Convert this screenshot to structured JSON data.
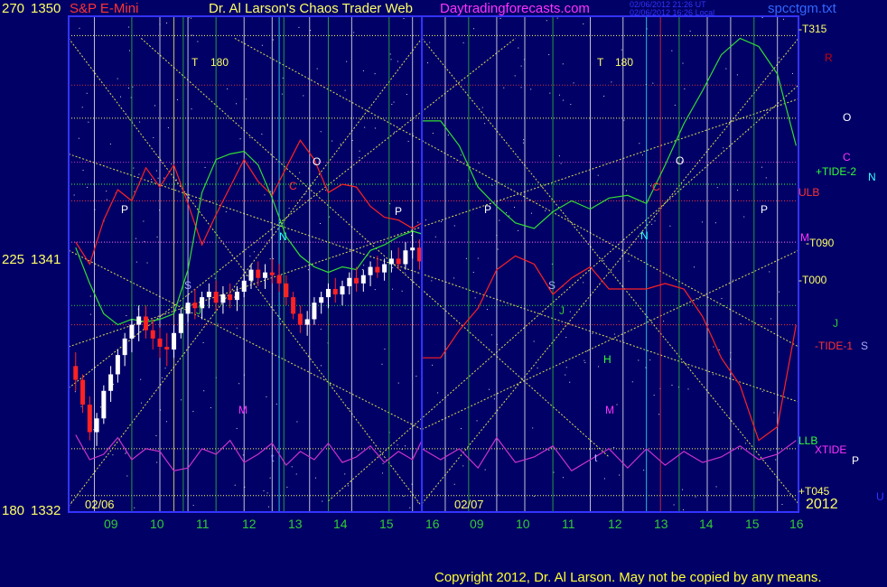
{
  "header": {
    "left_axis_label": "270",
    "top_price": "1350",
    "symbol": "S&P E-Mini",
    "title": "Dr. Al Larson's Chaos Trader Web",
    "site": "Daytradingforecasts.com",
    "stamp_line1": "02/06/2012 21:26 UT",
    "stamp_line2": "02/06/2012 16:26 Local",
    "filename": "spcctgm.txt"
  },
  "y_axis": {
    "mid_left": "225",
    "mid_price": "1341",
    "bottom_left": "180",
    "bottom_price": "1332"
  },
  "x_axis": {
    "day1_ticks": [
      "09",
      "10",
      "11",
      "12",
      "13",
      "14",
      "15",
      "16"
    ],
    "day2_ticks": [
      "09",
      "10",
      "11",
      "12",
      "13",
      "14",
      "15",
      "16"
    ],
    "date1": "02/06",
    "date2": "02/07",
    "year": "2012"
  },
  "right_labels": {
    "t315": "-T315",
    "r": "R",
    "o": "O",
    "c": "C",
    "tide2": "+TIDE-2",
    "n": "N",
    "ulb": "ULB",
    "m": "M",
    "t090": "-T090",
    "t000": "-T000",
    "j": "J",
    "tide1": "-TIDE-1",
    "s": "S",
    "llb": "LLB",
    "xtide": "XTIDE",
    "p": "P",
    "t045": "+T045",
    "u": "U"
  },
  "plot_letters": {
    "t1": "T",
    "t1_deg": "180",
    "t2": "T",
    "t2_deg": "180",
    "letters": [
      "P",
      "O",
      "C",
      "N",
      "P",
      "S",
      "J",
      "M",
      "t",
      "P",
      "S",
      "J",
      "H",
      "M",
      "N",
      "O",
      "C",
      "P",
      "t"
    ]
  },
  "copyright": "Copyright 2012, Dr. Al Larson. May not be copied by any means.",
  "chart_data": {
    "type": "line",
    "title": "S&P E-Mini",
    "ylim": [
      1332,
      1350
    ],
    "y_ticks": [
      1332,
      1341,
      1350
    ],
    "x_ticks_day1": [
      "09",
      "10",
      "11",
      "12",
      "13",
      "14",
      "15",
      "16"
    ],
    "x_ticks_day2": [
      "09",
      "10",
      "11",
      "12",
      "13",
      "14",
      "15",
      "16"
    ],
    "price_bars_day1": [
      {
        "x": 8.6,
        "o": 1337.3,
        "h": 1337.8,
        "l": 1336.4,
        "c": 1336.8
      },
      {
        "x": 8.75,
        "o": 1336.8,
        "h": 1337.0,
        "l": 1335.6,
        "c": 1335.9
      },
      {
        "x": 8.9,
        "o": 1335.9,
        "h": 1336.2,
        "l": 1334.6,
        "c": 1334.9
      },
      {
        "x": 9.05,
        "o": 1334.9,
        "h": 1335.6,
        "l": 1334.4,
        "c": 1335.4
      },
      {
        "x": 9.2,
        "o": 1335.4,
        "h": 1336.6,
        "l": 1335.2,
        "c": 1336.4
      },
      {
        "x": 9.35,
        "o": 1336.4,
        "h": 1337.3,
        "l": 1336.0,
        "c": 1337.0
      },
      {
        "x": 9.5,
        "o": 1337.0,
        "h": 1337.9,
        "l": 1336.7,
        "c": 1337.7
      },
      {
        "x": 9.65,
        "o": 1337.7,
        "h": 1338.5,
        "l": 1337.3,
        "c": 1338.3
      },
      {
        "x": 9.8,
        "o": 1338.3,
        "h": 1339.0,
        "l": 1337.8,
        "c": 1338.8
      },
      {
        "x": 9.95,
        "o": 1338.8,
        "h": 1339.5,
        "l": 1338.2,
        "c": 1339.1
      },
      {
        "x": 10.1,
        "o": 1339.1,
        "h": 1339.5,
        "l": 1338.3,
        "c": 1338.6
      },
      {
        "x": 10.25,
        "o": 1338.6,
        "h": 1339.0,
        "l": 1337.9,
        "c": 1338.3
      },
      {
        "x": 10.4,
        "o": 1338.3,
        "h": 1338.7,
        "l": 1337.6,
        "c": 1338.0
      },
      {
        "x": 10.55,
        "o": 1338.0,
        "h": 1338.5,
        "l": 1337.3,
        "c": 1337.9
      },
      {
        "x": 10.7,
        "o": 1337.9,
        "h": 1338.8,
        "l": 1337.6,
        "c": 1338.5
      },
      {
        "x": 10.85,
        "o": 1338.5,
        "h": 1339.4,
        "l": 1338.3,
        "c": 1339.2
      },
      {
        "x": 11.0,
        "o": 1339.2,
        "h": 1339.9,
        "l": 1338.9,
        "c": 1339.6
      },
      {
        "x": 11.15,
        "o": 1339.6,
        "h": 1340.1,
        "l": 1339.0,
        "c": 1339.4
      },
      {
        "x": 11.3,
        "o": 1339.4,
        "h": 1340.0,
        "l": 1339.0,
        "c": 1339.8
      },
      {
        "x": 11.45,
        "o": 1339.8,
        "h": 1340.3,
        "l": 1339.4,
        "c": 1340.0
      },
      {
        "x": 11.6,
        "o": 1340.0,
        "h": 1340.4,
        "l": 1339.3,
        "c": 1339.6
      },
      {
        "x": 11.75,
        "o": 1339.6,
        "h": 1340.2,
        "l": 1339.2,
        "c": 1339.9
      },
      {
        "x": 11.9,
        "o": 1339.9,
        "h": 1340.3,
        "l": 1339.4,
        "c": 1339.7
      },
      {
        "x": 12.05,
        "o": 1339.7,
        "h": 1340.2,
        "l": 1339.3,
        "c": 1340.0
      },
      {
        "x": 12.2,
        "o": 1340.0,
        "h": 1340.6,
        "l": 1339.8,
        "c": 1340.4
      },
      {
        "x": 12.35,
        "o": 1340.4,
        "h": 1341.0,
        "l": 1340.1,
        "c": 1340.8
      },
      {
        "x": 12.5,
        "o": 1340.8,
        "h": 1341.1,
        "l": 1340.2,
        "c": 1340.5
      },
      {
        "x": 12.65,
        "o": 1340.5,
        "h": 1341.0,
        "l": 1340.1,
        "c": 1340.7
      },
      {
        "x": 12.8,
        "o": 1340.7,
        "h": 1341.2,
        "l": 1340.3,
        "c": 1340.6
      },
      {
        "x": 12.95,
        "o": 1340.6,
        "h": 1341.0,
        "l": 1340.0,
        "c": 1340.3
      },
      {
        "x": 13.1,
        "o": 1340.3,
        "h": 1340.6,
        "l": 1339.5,
        "c": 1339.8
      },
      {
        "x": 13.25,
        "o": 1339.8,
        "h": 1340.0,
        "l": 1339.0,
        "c": 1339.2
      },
      {
        "x": 13.4,
        "o": 1339.2,
        "h": 1339.5,
        "l": 1338.5,
        "c": 1338.8
      },
      {
        "x": 13.55,
        "o": 1338.8,
        "h": 1339.3,
        "l": 1338.4,
        "c": 1339.0
      },
      {
        "x": 13.7,
        "o": 1339.0,
        "h": 1339.8,
        "l": 1338.8,
        "c": 1339.6
      },
      {
        "x": 13.85,
        "o": 1339.6,
        "h": 1340.0,
        "l": 1339.2,
        "c": 1339.8
      },
      {
        "x": 14.0,
        "o": 1339.8,
        "h": 1340.3,
        "l": 1339.4,
        "c": 1340.1
      },
      {
        "x": 14.15,
        "o": 1340.1,
        "h": 1340.5,
        "l": 1339.6,
        "c": 1339.9
      },
      {
        "x": 14.3,
        "o": 1339.9,
        "h": 1340.4,
        "l": 1339.5,
        "c": 1340.2
      },
      {
        "x": 14.45,
        "o": 1340.2,
        "h": 1340.7,
        "l": 1339.9,
        "c": 1340.5
      },
      {
        "x": 14.6,
        "o": 1340.5,
        "h": 1340.9,
        "l": 1340.0,
        "c": 1340.3
      },
      {
        "x": 14.75,
        "o": 1340.3,
        "h": 1340.8,
        "l": 1340.0,
        "c": 1340.6
      },
      {
        "x": 14.9,
        "o": 1340.6,
        "h": 1341.1,
        "l": 1340.2,
        "c": 1340.9
      },
      {
        "x": 15.05,
        "o": 1340.9,
        "h": 1341.3,
        "l": 1340.5,
        "c": 1340.7
      },
      {
        "x": 15.2,
        "o": 1340.7,
        "h": 1341.2,
        "l": 1340.4,
        "c": 1341.0
      },
      {
        "x": 15.35,
        "o": 1341.0,
        "h": 1341.5,
        "l": 1340.7,
        "c": 1341.2
      },
      {
        "x": 15.5,
        "o": 1341.2,
        "h": 1341.6,
        "l": 1340.8,
        "c": 1341.0
      },
      {
        "x": 15.65,
        "o": 1341.0,
        "h": 1341.8,
        "l": 1340.8,
        "c": 1341.5
      },
      {
        "x": 15.8,
        "o": 1341.5,
        "h": 1342.2,
        "l": 1341.2,
        "c": 1341.6
      },
      {
        "x": 15.95,
        "o": 1341.6,
        "h": 1341.9,
        "l": 1340.8,
        "c": 1341.1
      }
    ],
    "series": [
      {
        "name": "TIDE-1",
        "segment": 1,
        "x": [
          8.6,
          8.9,
          9.2,
          9.5,
          9.8,
          10.1,
          10.4,
          10.7,
          11.0,
          11.3,
          11.6,
          11.9,
          12.2,
          12.5,
          12.8,
          13.1,
          13.4,
          13.7,
          14.0,
          14.3,
          14.6,
          14.9,
          15.2,
          15.5,
          15.8,
          16.0
        ],
        "y": [
          1341.8,
          1341.0,
          1342.6,
          1343.7,
          1343.3,
          1344.5,
          1343.8,
          1344.6,
          1343.2,
          1341.7,
          1342.8,
          1343.8,
          1344.8,
          1344.0,
          1343.5,
          1344.5,
          1345.5,
          1344.8,
          1343.6,
          1343.9,
          1343.8,
          1343.1,
          1342.7,
          1342.6,
          1342.3,
          1342.5
        ]
      },
      {
        "name": "TIDE-2",
        "segment": 1,
        "x": [
          8.6,
          8.9,
          9.2,
          9.5,
          9.8,
          10.1,
          10.4,
          10.7,
          11.0,
          11.3,
          11.6,
          11.9,
          12.2,
          12.5,
          12.8,
          13.1,
          13.4,
          13.7,
          14.0,
          14.3,
          14.6,
          14.9,
          15.2,
          15.5,
          15.8,
          16.0
        ],
        "y": [
          1341.6,
          1340.3,
          1339.2,
          1338.8,
          1339.0,
          1338.9,
          1339.0,
          1339.2,
          1340.8,
          1343.6,
          1344.8,
          1345.0,
          1345.1,
          1344.6,
          1343.4,
          1342.0,
          1341.3,
          1340.9,
          1340.7,
          1340.9,
          1340.8,
          1341.5,
          1341.7,
          1342.0,
          1342.2,
          1342.1
        ]
      },
      {
        "name": "TIDE-1",
        "segment": 2,
        "x": [
          16.0,
          16.4,
          16.8,
          17.2,
          17.6,
          18.0,
          18.4,
          18.8,
          19.2,
          19.6,
          20.0,
          20.4,
          20.8,
          21.2,
          21.6,
          22.0,
          22.4,
          22.8,
          23.2,
          23.6,
          24.0
        ],
        "y": [
          1337.6,
          1337.6,
          1338.6,
          1339.4,
          1340.8,
          1341.3,
          1341.0,
          1339.9,
          1340.5,
          1340.9,
          1340.1,
          1340.1,
          1340.1,
          1340.3,
          1340.1,
          1339.1,
          1337.6,
          1336.6,
          1334.6,
          1335.1,
          1338.8
        ]
      },
      {
        "name": "TIDE-2",
        "segment": 2,
        "x": [
          16.0,
          16.4,
          16.8,
          17.2,
          17.6,
          18.0,
          18.4,
          18.8,
          19.2,
          19.6,
          20.0,
          20.4,
          20.8,
          21.2,
          21.6,
          22.0,
          22.4,
          22.8,
          23.2,
          23.6,
          24.0
        ],
        "y": [
          1346.2,
          1346.2,
          1345.3,
          1343.8,
          1343.1,
          1342.5,
          1342.3,
          1342.9,
          1343.3,
          1343.0,
          1343.4,
          1343.5,
          1343.2,
          1344.6,
          1346.1,
          1347.3,
          1348.6,
          1349.2,
          1348.9,
          1347.9,
          1345.3
        ]
      },
      {
        "name": "XTIDE",
        "segment": 1,
        "x": [
          8.6,
          8.9,
          9.2,
          9.5,
          9.8,
          10.1,
          10.4,
          10.7,
          11.0,
          11.3,
          11.6,
          11.9,
          12.2,
          12.5,
          12.8,
          13.1,
          13.4,
          13.7,
          14.0,
          14.3,
          14.6,
          14.9,
          15.2,
          15.5,
          15.8,
          16.0
        ],
        "y": [
          1334.8,
          1333.9,
          1334.1,
          1334.7,
          1333.9,
          1334.3,
          1334.2,
          1333.5,
          1333.6,
          1334.3,
          1334.1,
          1334.6,
          1333.8,
          1334.1,
          1334.5,
          1333.7,
          1334.2,
          1333.9,
          1334.5,
          1333.8,
          1334.0,
          1334.4,
          1333.8,
          1334.2,
          1333.9,
          1334.6
        ]
      },
      {
        "name": "XTIDE",
        "segment": 2,
        "x": [
          16.0,
          16.4,
          16.8,
          17.2,
          17.6,
          18.0,
          18.4,
          18.8,
          19.2,
          19.6,
          20.0,
          20.4,
          20.8,
          21.2,
          21.6,
          22.0,
          22.4,
          22.8,
          23.2,
          23.6,
          24.0
        ],
        "y": [
          1334.3,
          1333.9,
          1334.3,
          1333.6,
          1334.7,
          1333.8,
          1334.0,
          1334.4,
          1333.5,
          1333.9,
          1334.3,
          1333.6,
          1334.3,
          1333.7,
          1334.2,
          1333.8,
          1334.0,
          1334.4,
          1333.9,
          1334.1,
          1334.6
        ]
      }
    ],
    "annotations": [
      "-T315",
      "ULB",
      "-T090",
      "-T000",
      "-TIDE-1",
      "+TIDE-2",
      "LLB",
      "XTIDE",
      "+T045"
    ]
  }
}
